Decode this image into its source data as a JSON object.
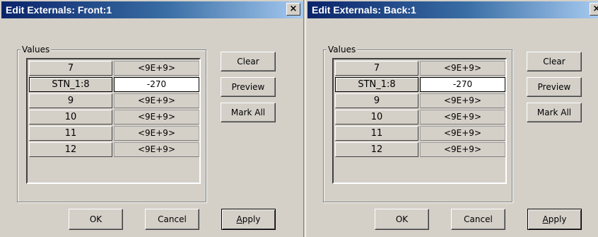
{
  "close_glyph": "×",
  "dialogs": [
    {
      "title": "Edit Externals: Front:1",
      "group_label": "Values",
      "rows": [
        {
          "key": "7",
          "value": "<9E+9>"
        },
        {
          "key": "STN_1:8",
          "value": "-270"
        },
        {
          "key": "9",
          "value": "<9E+9>"
        },
        {
          "key": "10",
          "value": "<9E+9>"
        },
        {
          "key": "11",
          "value": "<9E+9>"
        },
        {
          "key": "12",
          "value": "<9E+9>"
        }
      ],
      "side_buttons": {
        "clear": "Clear",
        "preview": "Preview",
        "mark_all": "Mark All"
      },
      "bottom_buttons": {
        "ok": "OK",
        "cancel": "Cancel",
        "apply_mnemonic": "A",
        "apply_rest": "pply"
      }
    },
    {
      "title": "Edit Externals: Back:1",
      "group_label": "Values",
      "rows": [
        {
          "key": "7",
          "value": "<9E+9>"
        },
        {
          "key": "STN_1:8",
          "value": "-270"
        },
        {
          "key": "9",
          "value": "<9E+9>"
        },
        {
          "key": "10",
          "value": "<9E+9>"
        },
        {
          "key": "11",
          "value": "<9E+9>"
        },
        {
          "key": "12",
          "value": "<9E+9>"
        }
      ],
      "side_buttons": {
        "clear": "Clear",
        "preview": "Preview",
        "mark_all": "Mark All"
      },
      "bottom_buttons": {
        "ok": "OK",
        "cancel": "Cancel",
        "apply_mnemonic": "A",
        "apply_rest": "pply"
      }
    }
  ]
}
